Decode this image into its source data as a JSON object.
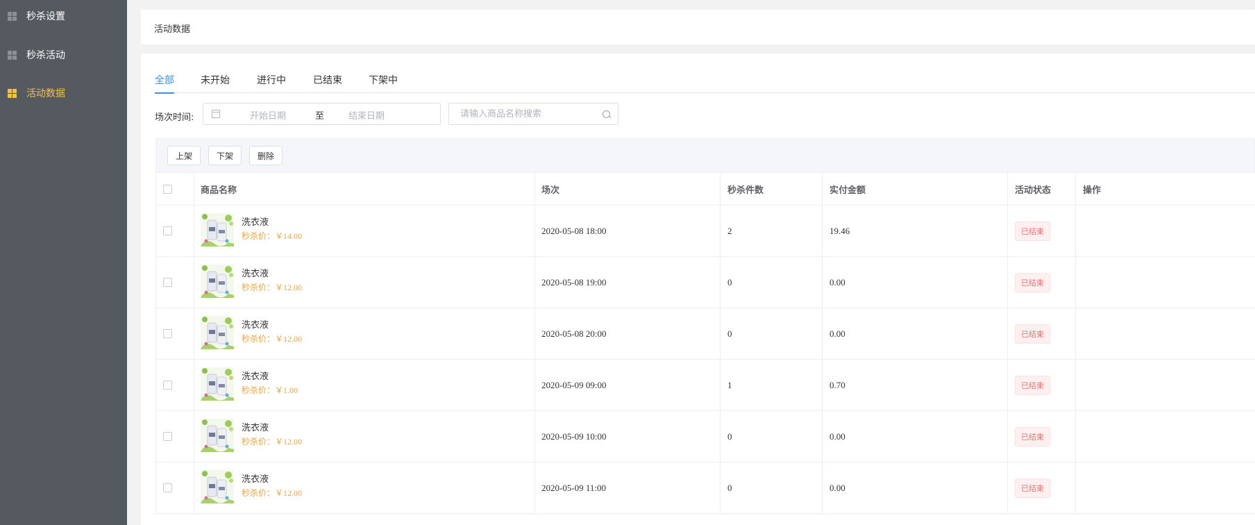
{
  "sidebar": {
    "items": [
      {
        "label": "秒杀设置",
        "active": false
      },
      {
        "label": "秒杀活动",
        "active": false
      },
      {
        "label": "活动数据",
        "active": true
      }
    ]
  },
  "header": {
    "title": "活动数据"
  },
  "tabs": [
    {
      "label": "全部",
      "active": true
    },
    {
      "label": "未开始",
      "active": false
    },
    {
      "label": "进行中",
      "active": false
    },
    {
      "label": "已结束",
      "active": false
    },
    {
      "label": "下架中",
      "active": false
    }
  ],
  "filter": {
    "label": "场次时间:",
    "date_start_placeholder": "开始日期",
    "date_separator": "至",
    "date_end_placeholder": "结束日期",
    "search_placeholder": "请输入商品名称搜索"
  },
  "actions": {
    "shelve": "上架",
    "unshelve": "下架",
    "delete": "删除"
  },
  "table": {
    "headers": {
      "product": "商品名称",
      "session": "场次",
      "count": "秒杀件数",
      "amount": "实付金额",
      "status": "活动状态",
      "operation": "操作"
    },
    "price_label": "秒杀价：",
    "rows": [
      {
        "name": "洗衣液",
        "price": "￥14.00",
        "session": "2020-05-08 18:00",
        "count": "2",
        "amount": "19.46",
        "status": "已结束"
      },
      {
        "name": "洗衣液",
        "price": "￥12.00",
        "session": "2020-05-08 19:00",
        "count": "0",
        "amount": "0.00",
        "status": "已结束"
      },
      {
        "name": "洗衣液",
        "price": "￥12.00",
        "session": "2020-05-08 20:00",
        "count": "0",
        "amount": "0.00",
        "status": "已结束"
      },
      {
        "name": "洗衣液",
        "price": "￥1.00",
        "session": "2020-05-09 09:00",
        "count": "1",
        "amount": "0.70",
        "status": "已结束"
      },
      {
        "name": "洗衣液",
        "price": "￥12.00",
        "session": "2020-05-09 10:00",
        "count": "0",
        "amount": "0.00",
        "status": "已结束"
      },
      {
        "name": "洗衣液",
        "price": "￥12.00",
        "session": "2020-05-09 11:00",
        "count": "0",
        "amount": "0.00",
        "status": "已结束"
      }
    ]
  },
  "colors": {
    "sidebar_bg": "#545a60",
    "active": "#f5c338",
    "tab_active": "#3a8ee6",
    "price": "#f0a33c",
    "status": "#f56c6c"
  },
  "icons": {
    "menu": "grid-icon",
    "calendar": "calendar-icon",
    "search": "search-icon",
    "product": "product-thumbnail"
  }
}
